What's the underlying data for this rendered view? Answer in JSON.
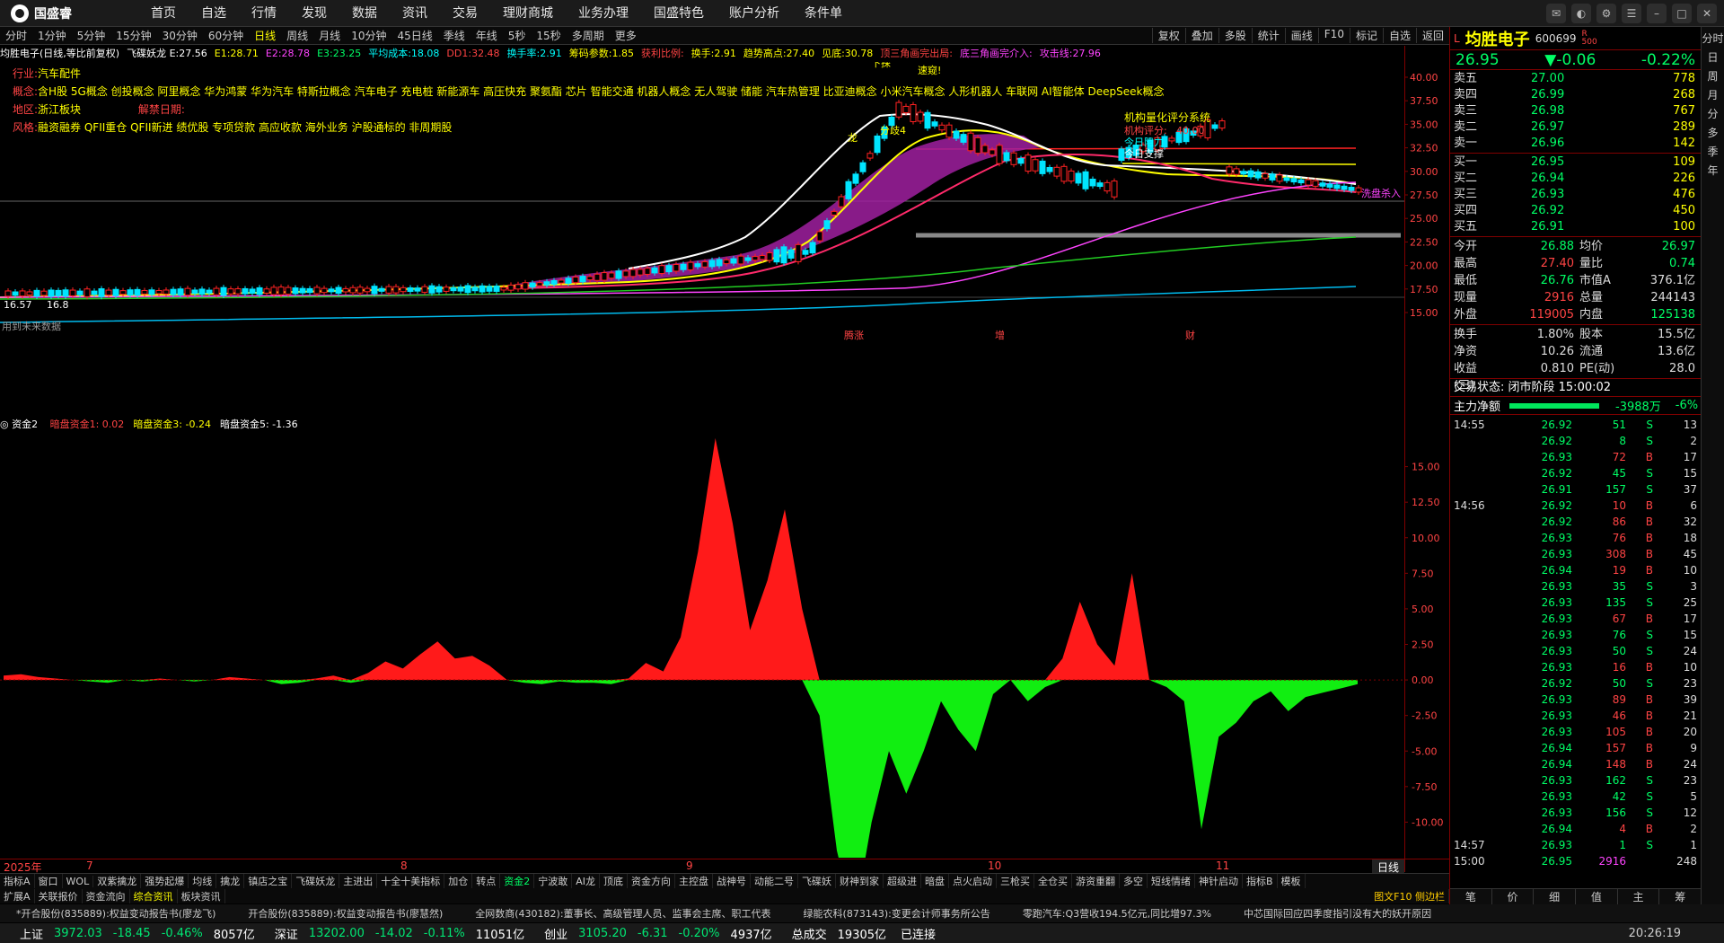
{
  "app": {
    "logo_text": "国盛睿",
    "nav": [
      "首页",
      "自选",
      "行情",
      "发现",
      "数据",
      "资讯",
      "交易",
      "理财商城",
      "业务办理",
      "国盛特色",
      "账户分析",
      "条件单"
    ]
  },
  "periodbar": {
    "periods": [
      "分时",
      "1分钟",
      "5分钟",
      "15分钟",
      "30分钟",
      "60分钟",
      "日线",
      "周线",
      "月线",
      "10分钟",
      "45日线",
      "季线",
      "年线",
      "5秒",
      "15秒",
      "多周期",
      "更多"
    ],
    "active_index": 6,
    "right_buttons": [
      "复权",
      "叠加",
      "多股",
      "统计",
      "画线",
      "F10",
      "标记",
      "自选",
      "返回"
    ]
  },
  "chart_info": [
    {
      "text": "均胜电子(日线,等比前复权)",
      "color": "#ffffff"
    },
    {
      "text": "飞碟妖龙 E:27.56",
      "color": "#ffffff"
    },
    {
      "text": "E1:28.71",
      "color": "#ffff00"
    },
    {
      "text": "E2:28.78",
      "color": "#ff44ff"
    },
    {
      "text": "E3:23.25",
      "color": "#00ff66"
    },
    {
      "text": "平均成本:18.08",
      "color": "#00ffff"
    },
    {
      "text": "DD1:32.48",
      "color": "#ff4444"
    },
    {
      "text": "换手率:2.91",
      "color": "#00ffff"
    },
    {
      "text": "筹码参数:1.85",
      "color": "#ffff00"
    },
    {
      "text": "获利比例:",
      "color": "#ff4444"
    },
    {
      "text": "换手:2.91",
      "color": "#ffff00"
    },
    {
      "text": "趋势高点:27.40",
      "color": "#ffff00"
    },
    {
      "text": "见底:30.78",
      "color": "#ffff00"
    },
    {
      "text": "顶三角画完出局:",
      "color": "#ff4444"
    },
    {
      "text": "底三角画完介入:",
      "color": "#ff44ff"
    },
    {
      "text": "攻击线:27.96",
      "color": "#ff44ff"
    }
  ],
  "tags": {
    "industry_label": "行业:",
    "industry": "汽车配件",
    "concept_label": "概念:",
    "concepts": "含H股 5G概念 创投概念 阿里概念 华为鸿蒙 华为汽车 特斯拉概念 汽车电子 充电桩 新能源车 高压快充 聚氨酯 芯片 智能交通 机器人概念 无人驾驶 储能 汽车热管理 比亚迪概念 小米汽车概念 人形机器人 车联网 AI智能体 DeepSeek概念",
    "region_label": "地区:",
    "region": "浙江板块",
    "unlock_label": "解禁日期:",
    "unlock": "",
    "style_label": "风格:",
    "style": "融资融券 QFII重仓 QFII新进 绩优股 专项贷款 高应收款 海外业务 沪股通标的 非周期股"
  },
  "price_axis": [
    "40.00",
    "37.50",
    "35.00",
    "32.50",
    "30.00",
    "27.50",
    "25.00",
    "22.50",
    "20.00",
    "17.50",
    "15.00"
  ],
  "price_annotations": {
    "low_label": "16.57",
    "low_value": "16.8",
    "future": "用到未来数据",
    "system": "机构量化评分系统",
    "score": "机构评分:",
    "score_val": "40.00",
    "pressure": "今日阻力",
    "support": "今日支撑",
    "wash": "洗盘杀入",
    "marks": [
      "腾涨",
      "增",
      "财"
    ],
    "dragon": [
      "下探",
      "速窥!",
      "龙",
      "分歧4"
    ]
  },
  "indicator": {
    "name": "资金2",
    "items": [
      {
        "text": "暗盘资金1: 0.02",
        "color": "#ff4444"
      },
      {
        "text": "暗盘资金3: -0.24",
        "color": "#ffff00"
      },
      {
        "text": "暗盘资金5: -1.36",
        "color": "#ffffff"
      }
    ],
    "axis": [
      "15.00",
      "12.50",
      "10.00",
      "7.50",
      "5.00",
      "2.50",
      "0.00",
      "-2.50",
      "-5.00",
      "-7.50",
      "-10.00"
    ]
  },
  "chart_data": {
    "type": "area",
    "title": "资金2",
    "xlabel": "",
    "ylabel": "",
    "ylim": [
      -12.5,
      17.5
    ],
    "x_labels": [
      "2025年",
      "7",
      "8",
      "9",
      "10",
      "11"
    ],
    "series": [
      {
        "name": "暗盘资金",
        "values": [
          0.3,
          0.4,
          0.2,
          0.1,
          0.0,
          -0.1,
          -0.2,
          0.0,
          -0.1,
          0.1,
          0.0,
          -0.1,
          0.0,
          0.2,
          0.1,
          0.0,
          -0.3,
          -0.2,
          0.1,
          0.3,
          -0.2,
          0.5,
          1.3,
          0.8,
          1.8,
          2.7,
          1.5,
          1.7,
          1.0,
          0.0,
          -0.2,
          -0.3,
          -0.1,
          -0.2,
          -0.2,
          -0.3,
          0.1,
          1.2,
          0.6,
          3.0,
          9.0,
          17.0,
          11.0,
          3.5,
          7.0,
          12.0,
          5.0,
          -2.5,
          -12.0,
          -17.0,
          -10.0,
          -5.0,
          -8.0,
          -5.0,
          -1.5,
          -3.5,
          -5.0,
          -1.0,
          0.0,
          -1.5,
          -0.5,
          1.5,
          5.5,
          2.5,
          1.0,
          7.5,
          0.0,
          -0.5,
          -1.5,
          -10.5,
          -4.0,
          -3.0,
          -1.5,
          -0.8,
          -2.2,
          -1.2,
          -0.9,
          -0.6,
          -0.3
        ]
      }
    ]
  },
  "datebar": {
    "labels": [
      "2025年",
      "7",
      "8",
      "9",
      "10",
      "11"
    ],
    "day_btn": "日线"
  },
  "tabs1": [
    "指标A",
    "窗口",
    "WOL",
    "双紫擒龙",
    "强势起爆",
    "均线",
    "擒龙",
    "镇店之宝",
    "飞碟妖龙",
    "主进出",
    "十全十美指标",
    "加仓",
    "转点",
    "资金2",
    "宁波敢",
    "AI龙",
    "顶底",
    "资金方向",
    "主控盘",
    "战神号",
    "动能二号",
    "飞碟妖",
    "财神到家",
    "超级进",
    "暗盘",
    "点火启动",
    "三枪买",
    "全仓买",
    "游资重翻",
    "多空",
    "短线情绪",
    "神针启动",
    "指标B",
    "模板"
  ],
  "tabs1_hl": 13,
  "tabs2": [
    "扩展A",
    "关联报价",
    "资金流向",
    "综合资讯",
    "板块资讯"
  ],
  "tabs2_hl": 3,
  "tabs2_right": "图文F10 侧边栏",
  "news": [
    "*开合股份(835889):权益变动报告书(廖龙飞)",
    "开合股份(835889):权益变动报告书(廖慧然)",
    "全网数商(430182):董事长、高级管理人员、监事会主席、职工代表",
    "绿能农科(873143):变更会计师事务所公告",
    "零跑汽车:Q3营收194.5亿元,同比增97.3%",
    "中芯国际回应四季度指引没有大的妖开原因"
  ],
  "status": {
    "sh_label": "上证",
    "sh": "3972.03",
    "sh_chg": "-18.45",
    "sh_pct": "-0.46%",
    "sh_amt": "8057亿",
    "sz_label": "深证",
    "sz": "13202.00",
    "sz_chg": "-14.02",
    "sz_pct": "-0.11%",
    "sz_amt": "11051亿",
    "cy_label": "创业",
    "cy": "3105.20",
    "cy_chg": "-6.31",
    "cy_pct": "-0.20%",
    "cy_amt": "4937亿",
    "total_label": "总成交",
    "total": "19305亿",
    "conn": "已连接",
    "time": "20:26:19"
  },
  "stock": {
    "prefix": "L",
    "name": "均胜电子",
    "code": "600699",
    "rz": "R\n500",
    "price": "26.95",
    "change": "▼-0.06",
    "pct": "-0.22%",
    "asks": [
      {
        "label": "卖五",
        "price": "27.00",
        "vol": "778"
      },
      {
        "label": "卖四",
        "price": "26.99",
        "vol": "268"
      },
      {
        "label": "卖三",
        "price": "26.98",
        "vol": "767"
      },
      {
        "label": "卖二",
        "price": "26.97",
        "vol": "289"
      },
      {
        "label": "卖一",
        "price": "26.96",
        "vol": "142"
      }
    ],
    "bids": [
      {
        "label": "买一",
        "price": "26.95",
        "vol": "109"
      },
      {
        "label": "买二",
        "price": "26.94",
        "vol": "226"
      },
      {
        "label": "买三",
        "price": "26.93",
        "vol": "476"
      },
      {
        "label": "买四",
        "price": "26.92",
        "vol": "450"
      },
      {
        "label": "买五",
        "price": "26.91",
        "vol": "100"
      }
    ],
    "stats": [
      {
        "k": "今开",
        "v": "26.88",
        "vc": "c-g",
        "k2": "均价",
        "v2": "26.97",
        "v2c": "c-g"
      },
      {
        "k": "最高",
        "v": "27.40",
        "vc": "c-r",
        "k2": "量比",
        "v2": "0.74",
        "v2c": "c-g"
      },
      {
        "k": "最低",
        "v": "26.76",
        "vc": "c-g",
        "k2": "市值A",
        "v2": "376.1亿",
        "v2c": "c-w"
      },
      {
        "k": "现量",
        "v": "2916",
        "vc": "c-r",
        "k2": "总量",
        "v2": "244143",
        "v2c": "c-w"
      },
      {
        "k": "外盘",
        "v": "119005",
        "vc": "c-r",
        "k2": "内盘",
        "v2": "125138",
        "v2c": "c-g"
      }
    ],
    "stats2": [
      {
        "k": "换手",
        "v": "1.80%",
        "vc": "c-w",
        "k2": "股本",
        "v2": "15.5亿",
        "v2c": "c-w"
      },
      {
        "k": "净资",
        "v": "10.26",
        "vc": "c-w",
        "k2": "流通",
        "v2": "13.6亿",
        "v2c": "c-w"
      },
      {
        "k": "收益(三)",
        "v": "0.810",
        "vc": "c-w",
        "k2": "PE(动)",
        "v2": "28.0",
        "v2c": "c-w"
      }
    ],
    "trade_state": "交易状态: 闭市阶段 15:00:02",
    "netflow_label": "主力净额",
    "netflow": "-3988万",
    "netflow_pct": "-6%",
    "ticks": [
      {
        "t": "14:55",
        "p": "26.92",
        "v": "51",
        "bs": "S",
        "c": "13"
      },
      {
        "t": "",
        "p": "26.92",
        "v": "8",
        "bs": "S",
        "c": "2"
      },
      {
        "t": "",
        "p": "26.93",
        "v": "72",
        "bs": "B",
        "c": "17"
      },
      {
        "t": "",
        "p": "26.92",
        "v": "45",
        "bs": "S",
        "c": "15"
      },
      {
        "t": "",
        "p": "26.91",
        "v": "157",
        "bs": "S",
        "c": "37"
      },
      {
        "t": "14:56",
        "p": "26.92",
        "v": "10",
        "bs": "B",
        "c": "6"
      },
      {
        "t": "",
        "p": "26.92",
        "v": "86",
        "bs": "B",
        "c": "32"
      },
      {
        "t": "",
        "p": "26.93",
        "v": "76",
        "bs": "B",
        "c": "18"
      },
      {
        "t": "",
        "p": "26.93",
        "v": "308",
        "bs": "B",
        "c": "45"
      },
      {
        "t": "",
        "p": "26.94",
        "v": "19",
        "bs": "B",
        "c": "10"
      },
      {
        "t": "",
        "p": "26.93",
        "v": "35",
        "bs": "S",
        "c": "3"
      },
      {
        "t": "",
        "p": "26.93",
        "v": "135",
        "bs": "S",
        "c": "25"
      },
      {
        "t": "",
        "p": "26.93",
        "v": "67",
        "bs": "B",
        "c": "17"
      },
      {
        "t": "",
        "p": "26.93",
        "v": "76",
        "bs": "S",
        "c": "15"
      },
      {
        "t": "",
        "p": "26.93",
        "v": "50",
        "bs": "S",
        "c": "24"
      },
      {
        "t": "",
        "p": "26.93",
        "v": "16",
        "bs": "B",
        "c": "10"
      },
      {
        "t": "",
        "p": "26.92",
        "v": "50",
        "bs": "S",
        "c": "23"
      },
      {
        "t": "",
        "p": "26.93",
        "v": "89",
        "bs": "B",
        "c": "39"
      },
      {
        "t": "",
        "p": "26.93",
        "v": "46",
        "bs": "B",
        "c": "21"
      },
      {
        "t": "",
        "p": "26.93",
        "v": "105",
        "bs": "B",
        "c": "20"
      },
      {
        "t": "",
        "p": "26.94",
        "v": "157",
        "bs": "B",
        "c": "9"
      },
      {
        "t": "",
        "p": "26.94",
        "v": "148",
        "bs": "B",
        "c": "24"
      },
      {
        "t": "",
        "p": "26.93",
        "v": "162",
        "bs": "S",
        "c": "23"
      },
      {
        "t": "",
        "p": "26.93",
        "v": "42",
        "bs": "S",
        "c": "5"
      },
      {
        "t": "",
        "p": "26.93",
        "v": "156",
        "bs": "S",
        "c": "12"
      },
      {
        "t": "",
        "p": "26.94",
        "v": "4",
        "bs": "B",
        "c": "2"
      },
      {
        "t": "14:57",
        "p": "26.93",
        "v": "1",
        "bs": "S",
        "c": "1"
      },
      {
        "t": "15:00",
        "p": "26.95",
        "v": "2916",
        "bs": "",
        "c": "248"
      }
    ],
    "footer": [
      "笔",
      "价",
      "细",
      "值",
      "主",
      "筹"
    ]
  },
  "side_tabs": [
    "分时",
    "日",
    "周",
    "月",
    "分",
    "多",
    "季",
    "年"
  ]
}
